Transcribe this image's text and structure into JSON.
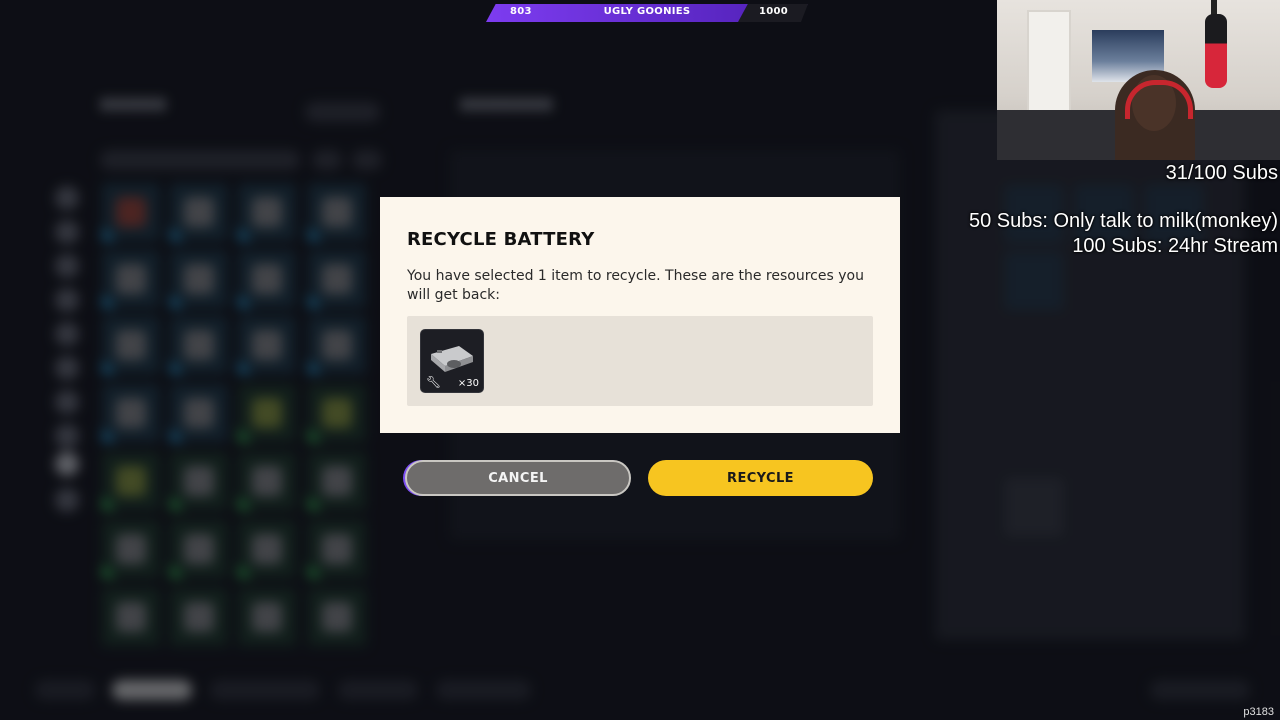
{
  "scorebar": {
    "left_score": "803",
    "title": "UGLY GOONIES",
    "right_score": "1000",
    "accent": "#7d3cf0"
  },
  "stream_overlay": {
    "subs_count": "31/100 Subs",
    "goal_50": "50 Subs: Only talk to milk(monkey)",
    "goal_100": "100 Subs: 24hr Stream",
    "watermark": "p3183"
  },
  "dialog": {
    "title": "RECYCLE BATTERY",
    "description": "You have selected 1 item to recycle. These are the resources you will get back:",
    "resources": [
      {
        "icon": "metal-parts-icon",
        "badge_icon": "wrench-icon",
        "quantity": "×30"
      }
    ],
    "cancel_label": "CANCEL",
    "recycle_label": "RECYCLE",
    "recycle_color": "#f7c520"
  }
}
